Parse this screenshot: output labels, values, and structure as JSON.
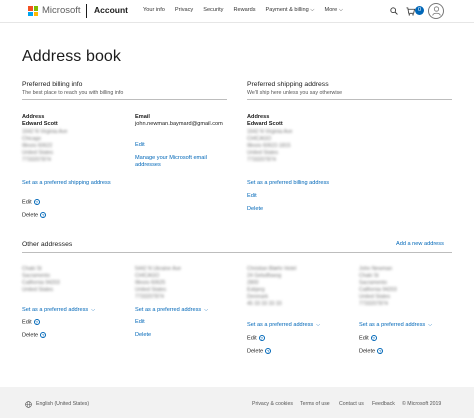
{
  "header": {
    "brand": "Microsoft",
    "section": "Account",
    "nav": [
      "Your info",
      "Privacy",
      "Security",
      "Rewards",
      "Payment & billing ⌵",
      "More ⌵"
    ],
    "cart_count": "0",
    "colors": {
      "logo_red": "#f25022",
      "logo_green": "#7fba00",
      "logo_blue": "#00a4ef",
      "logo_yellow": "#ffb900",
      "accent": "#0067b8"
    }
  },
  "page_title": "Address book",
  "billing": {
    "heading": "Preferred billing info",
    "sub": "The best place to reach you with billing info",
    "address_label": "Address",
    "name": "Edward Scott",
    "blurred_lines": [
      "1642 N Virginia Ave",
      "Chicago",
      "Illinois 60622",
      "United States",
      "7733207874"
    ],
    "set_link": "Set as a preferred shipping address",
    "edit": "Edit",
    "delete": "Delete",
    "email_label": "Email",
    "email_value": "john.newman.baymard@gmail.com",
    "email_edit": "Edit",
    "email_manage": "Manage your Microsoft email addresses"
  },
  "shipping": {
    "heading": "Preferred shipping address",
    "sub": "We'll ship here unless you say otherwise",
    "address_label": "Address",
    "name": "Edward Scott",
    "blurred_lines": [
      "1642 N Virginia Ave",
      "CHICAGO",
      "Illinois 60622-1815",
      "United States",
      "7733207874"
    ],
    "set_link": "Set as a preferred billing address",
    "edit": "Edit",
    "delete": "Delete"
  },
  "other": {
    "heading": "Other addresses",
    "add_link": "Add a new address",
    "cards": [
      {
        "blurred_lines": [
          "Chaki St",
          "Sacramento",
          "California 94203",
          "United States"
        ],
        "set_link": "Set as a preferred address",
        "edit": "Edit",
        "delete": "Delete"
      },
      {
        "blurred_lines": [
          "5442 N Ukraine Ave",
          "CHICAGO",
          "Illinois 60625",
          "United States",
          "7733207874"
        ],
        "set_link": "Set as a preferred address",
        "edit": "Edit",
        "delete": "Delete"
      },
      {
        "blurred_lines": [
          "Christian Blæhr Hotel",
          "24 Gelsdfswog",
          "2800",
          "Esbjerg",
          "Denmark",
          "45 33 33 33 33"
        ],
        "set_link": "Set as a preferred address",
        "edit": "Edit",
        "delete": "Delete"
      },
      {
        "blurred_lines": [
          "John Newman",
          "Chaki St",
          "Sacramento",
          "California 94203",
          "United States",
          "7733207874"
        ],
        "set_link": "Set as a preferred address",
        "edit": "Edit",
        "delete": "Delete"
      }
    ]
  },
  "footer": {
    "language": "English (United States)",
    "links": [
      "Privacy & cookies",
      "Terms of use",
      "Contact us",
      "Feedback",
      "© Microsoft 2019"
    ]
  }
}
